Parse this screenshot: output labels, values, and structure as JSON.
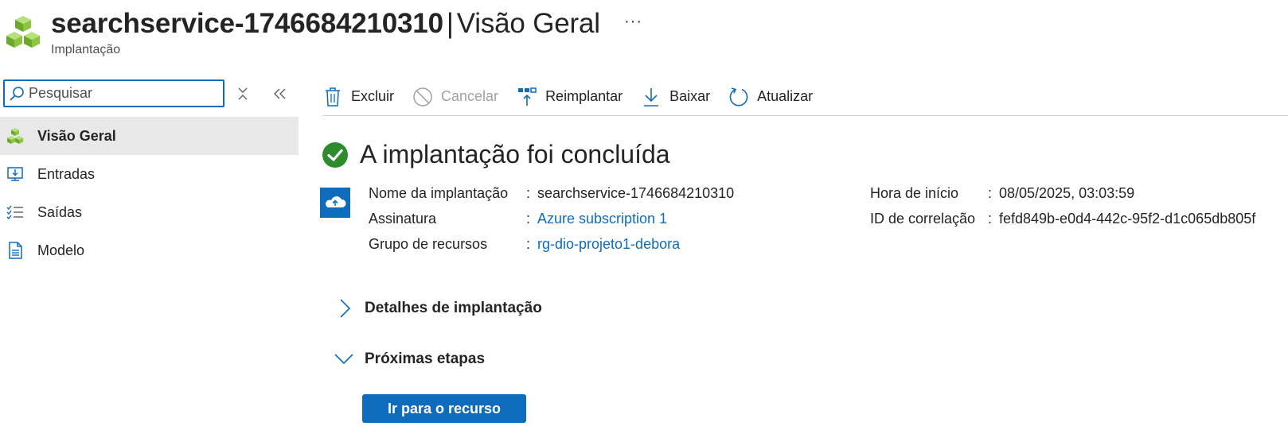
{
  "header": {
    "resource_name": "searchservice-1746684210310",
    "separator": "|",
    "page_title": "Visão Geral",
    "subtitle": "Implantação",
    "more_label": "···",
    "icon": "cubes-deployment-icon"
  },
  "sidebar": {
    "search": {
      "placeholder": "Pesquisar",
      "value": ""
    },
    "items": [
      {
        "label": "Visão Geral",
        "icon": "cubes-icon",
        "active": true
      },
      {
        "label": "Entradas",
        "icon": "inputs-icon",
        "active": false
      },
      {
        "label": "Saídas",
        "icon": "outputs-icon",
        "active": false
      },
      {
        "label": "Modelo",
        "icon": "template-icon",
        "active": false
      }
    ]
  },
  "toolbar": {
    "delete_label": "Excluir",
    "cancel_label": "Cancelar",
    "redeploy_label": "Reimplantar",
    "download_label": "Baixar",
    "refresh_label": "Atualizar"
  },
  "main": {
    "status_text": "A implantação foi concluída",
    "details": {
      "deployment_name_label": "Nome da implantação",
      "deployment_name_value": "searchservice-1746684210310",
      "subscription_label": "Assinatura",
      "subscription_value": "Azure subscription 1",
      "resource_group_label": "Grupo de recursos",
      "resource_group_value": "rg-dio-projeto1-debora",
      "start_time_label": "Hora de início",
      "start_time_value": "08/05/2025, 03:03:59",
      "correlation_label": "ID de correlação",
      "correlation_value": "fefd849b-e0d4-442c-95f2-d1c065db805f",
      "colon": ":"
    },
    "sections": {
      "deployment_details": "Detalhes de implantação",
      "next_steps": "Próximas etapas"
    },
    "go_to_resource_label": "Ir para o recurso"
  },
  "colors": {
    "accent": "#0f6cbd",
    "success": "#2e8b2e",
    "cube_green": "#8cc63f",
    "active_nav_bg": "#e8e8e8"
  }
}
